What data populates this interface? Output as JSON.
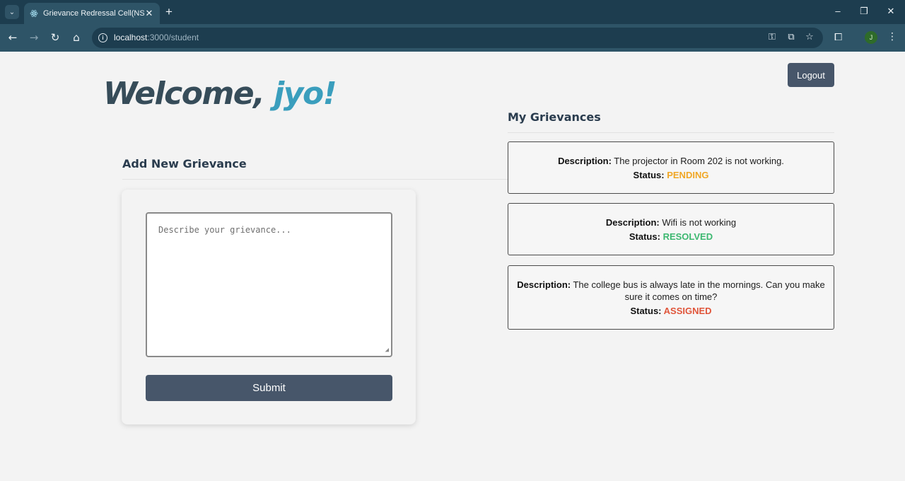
{
  "browser": {
    "tab_title": "Grievance Redressal Cell(NSS)",
    "url_host": "localhost",
    "url_path": ":3000/student",
    "profile_initial": "J",
    "icons": [
      "tab-list-icon",
      "react-favicon-icon",
      "close-icon",
      "plus-icon",
      "minimize-icon",
      "restore-icon",
      "window-close-icon",
      "back-icon",
      "forward-icon",
      "reload-icon",
      "home-icon",
      "info-icon",
      "key-icon",
      "install-icon",
      "star-icon",
      "extensions-icon",
      "kebab-menu-icon"
    ]
  },
  "header": {
    "welcome_prefix": "Welcome, ",
    "user_name": "jyo!",
    "logout_label": "Logout"
  },
  "add_form": {
    "heading": "Add New Grievance",
    "placeholder": "Describe your grievance...",
    "submit_label": "Submit"
  },
  "grievances": {
    "heading": "My Grievances",
    "description_label": "Description:",
    "status_label": "Status:",
    "items": [
      {
        "description": "The projector in Room 202 is not working.",
        "status": "PENDING",
        "status_color": "#f0a726"
      },
      {
        "description": "Wifi is not working",
        "status": "RESOLVED",
        "status_color": "#3cb870"
      },
      {
        "description": "The college bus is always late in the mornings. Can you make sure it comes on time?",
        "status": "ASSIGNED",
        "status_color": "#e0553a"
      }
    ]
  },
  "colors": {
    "primary_button": "#47566a",
    "accent_name": "#3a9ebd",
    "heading_text": "#2a3c4e"
  }
}
